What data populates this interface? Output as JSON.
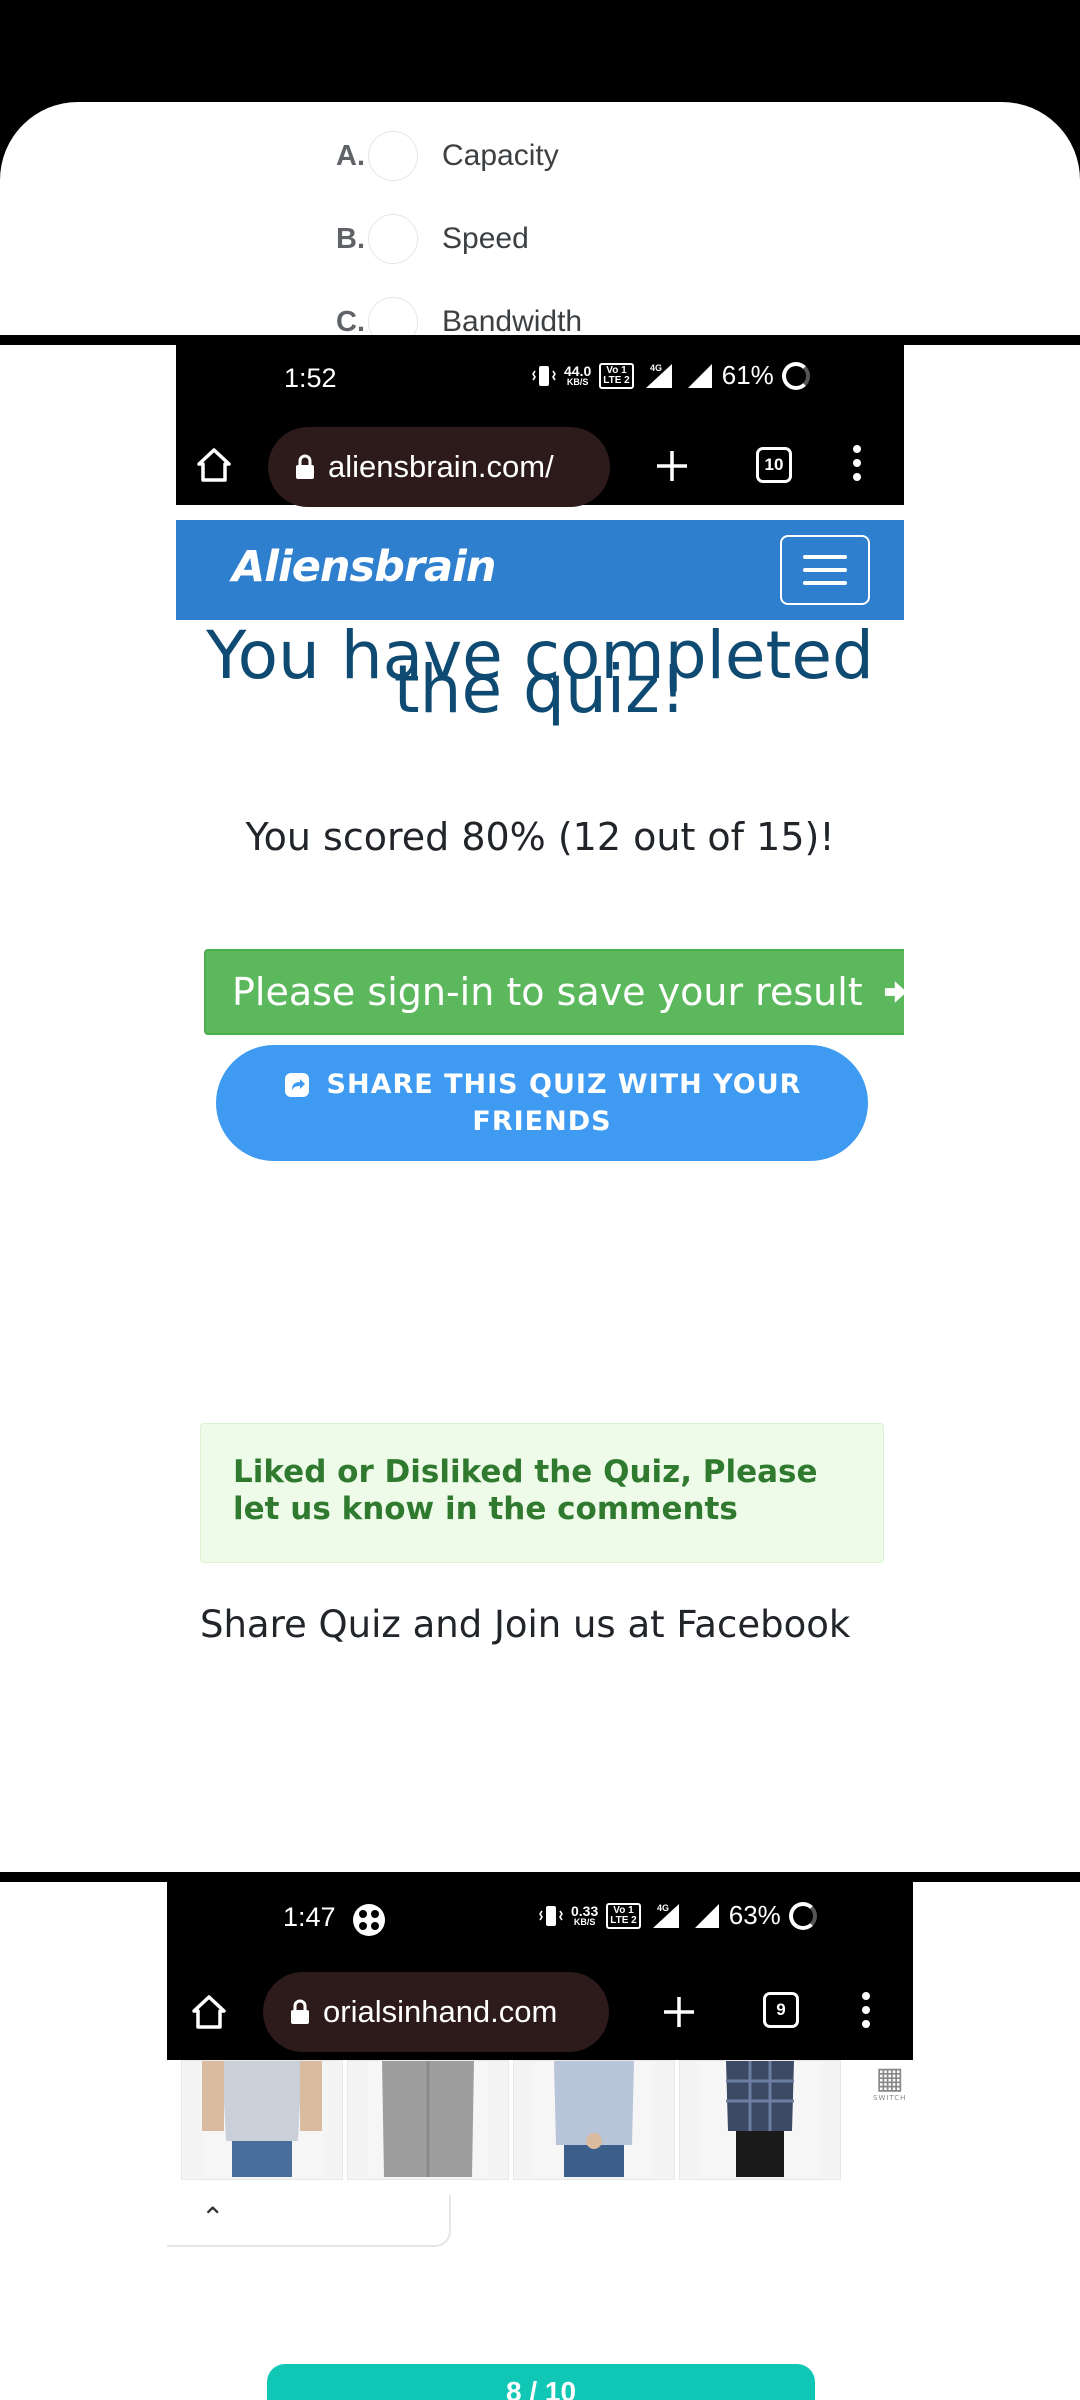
{
  "quiz_options": [
    {
      "letter": "A.",
      "text": "Capacity"
    },
    {
      "letter": "B.",
      "text": "Speed"
    },
    {
      "letter": "C.",
      "text": "Bandwidth"
    }
  ],
  "screen1": {
    "status": {
      "time": "1:52",
      "speed_value": "44.0",
      "speed_unit": "KB/S",
      "volte_top": "Vo 1",
      "volte_bottom": "LTE 2",
      "network": "4G",
      "battery": "61%"
    },
    "browser": {
      "url": "aliensbrain.com/",
      "tab_count": "10"
    },
    "site": {
      "brand": "Aliensbrain"
    },
    "result": {
      "heading_line1": "You have completed",
      "heading_line2": "the quiz!",
      "score": "You scored 80% (12 out of 15)!"
    },
    "signin_label": "Please sign-in to save your result",
    "share_label_line1": "SHARE THIS QUIZ WITH YOUR",
    "share_label_line2": "FRIENDS",
    "feedback": "Liked or Disliked the Quiz, Please let us know in the comments",
    "join_text": "Share Quiz and Join us at Facebook"
  },
  "screen2": {
    "status": {
      "time": "1:47",
      "speed_value": "0.33",
      "speed_unit": "KB/S",
      "volte_top": "Vo 1",
      "volte_bottom": "LTE 2",
      "network": "4G",
      "battery": "63%"
    },
    "browser": {
      "url": "orialsinhand.com",
      "tab_count": "9"
    },
    "logo_text": "SWITCH",
    "pager": "8 / 10"
  },
  "colors": {
    "brand_bar": "#2f7fcf",
    "heading": "#0e4a72",
    "signin": "#5cb85c",
    "share": "#3f9bf2",
    "feedback_text": "#2f7a2f",
    "pager": "#10c6b4"
  }
}
